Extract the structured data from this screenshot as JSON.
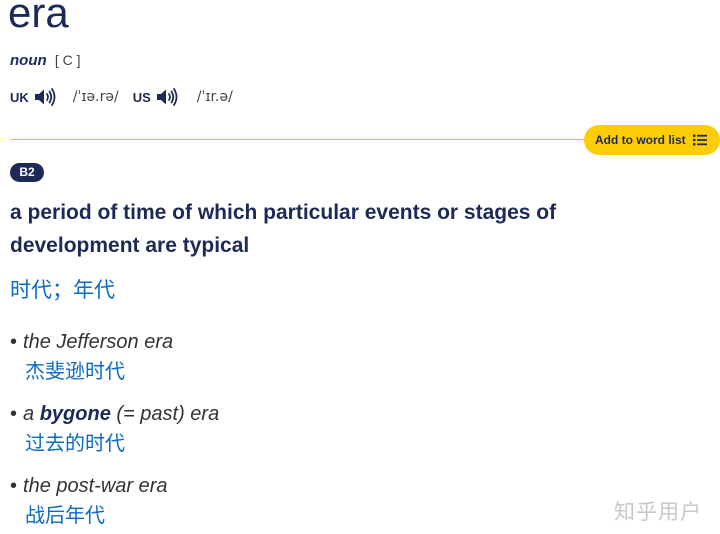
{
  "entry": {
    "headword": "era",
    "pos": "noun",
    "grammar": "[ C ]"
  },
  "pronunciation": {
    "uk": {
      "label": "UK",
      "ipa": "/ˈɪə.rə/"
    },
    "us": {
      "label": "US",
      "ipa": "/ˈɪr.ə/"
    }
  },
  "actions": {
    "add_to_word_list": "Add to word list",
    "list_icon": "list-icon"
  },
  "sense": {
    "level": "B2",
    "definition": "a period of time of which particular events or stages of development are typical",
    "translation": "时代；年代",
    "examples": [
      {
        "text": "the Jefferson era",
        "translation": "杰斐逊时代"
      },
      {
        "pre": "a ",
        "bold": "bygone",
        "post": " (= past) era",
        "translation": "过去的时代"
      },
      {
        "text": "the post-war era",
        "translation": "战后年代"
      }
    ]
  },
  "watermark": "知乎用户",
  "colors": {
    "navy": "#1d2a57",
    "accent_yellow": "#fecd07",
    "translation_blue": "#0c6bc2"
  }
}
